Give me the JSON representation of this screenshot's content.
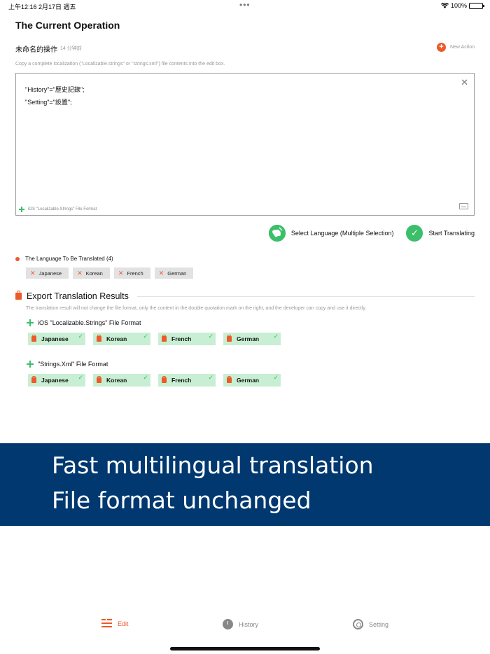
{
  "status_bar": {
    "time": "上午12:16  2月17日 週五",
    "dots": "•••",
    "battery": "100%"
  },
  "header": {
    "title": "The Current Operation",
    "operation_name": "未命名的操作",
    "operation_time": "14 分钟前",
    "new_action_label": "New Action",
    "new_action_icon": "+"
  },
  "editor": {
    "hint": "Copy a complete localization (\"Localizable.strings\" or \"strings.xml\") file contents into the edit box.",
    "lines": [
      "\"History\"=\"歷史記錄\";",
      "\"Setting\"=\"設置\";"
    ],
    "close_icon": "✕",
    "format_label": "iOS \"Localizable.Strings\" File Format"
  },
  "actions": {
    "select_language": "Select Language (Multiple Selection)",
    "start_translating": "Start Translating",
    "check_icon": "✓"
  },
  "languages": {
    "title": "The Language To Be Translated (4)",
    "remove_icon": "✕",
    "items": [
      "Japanese",
      "Korean",
      "French",
      "German"
    ]
  },
  "export": {
    "title": "Export Translation Results",
    "note": "The translation result will not change the file format, only the content in the double quotation mark on the right, and the developer can copy and use it directly.",
    "tick_icon": "✓",
    "formats": [
      {
        "title": "iOS \"Localizable.Strings\" File Format",
        "items": [
          "Japanese",
          "Korean",
          "French",
          "German"
        ]
      },
      {
        "title": "\"Strings.Xml\" File Format",
        "items": [
          "Japanese",
          "Korean",
          "French",
          "German"
        ]
      }
    ]
  },
  "banner": {
    "line1": "Fast multilingual translation",
    "line2": "File format unchanged"
  },
  "tabbar": {
    "edit": "Edit",
    "history": "History",
    "setting": "Setting"
  },
  "colors": {
    "accent": "#ec5a2a",
    "success": "#3cbf6a",
    "banner": "#00386f"
  }
}
